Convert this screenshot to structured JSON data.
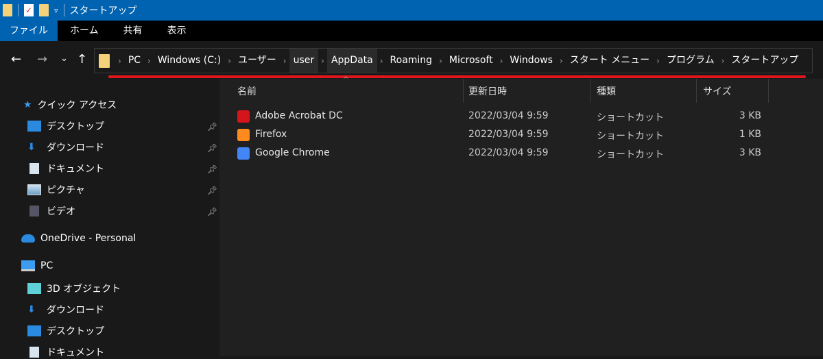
{
  "window": {
    "title": "スタートアップ"
  },
  "ribbon": {
    "tabs": [
      "ファイル",
      "ホーム",
      "共有",
      "表示"
    ]
  },
  "nav": {
    "back": "←",
    "forward": "→",
    "recent": "⌄",
    "up": "↑"
  },
  "breadcrumb": [
    "PC",
    "Windows (C:)",
    "ユーザー",
    "user",
    "AppData",
    "Roaming",
    "Microsoft",
    "Windows",
    "スタート メニュー",
    "プログラム",
    "スタートアップ"
  ],
  "sidebar": {
    "quick_access": "クイック アクセス",
    "quick_items": [
      "デスクトップ",
      "ダウンロード",
      "ドキュメント",
      "ピクチャ",
      "ビデオ"
    ],
    "onedrive": "OneDrive - Personal",
    "pc": "PC",
    "pc_items": [
      "3D オブジェクト",
      "ダウンロード",
      "デスクトップ",
      "ドキュメント"
    ]
  },
  "columns": {
    "name": "名前",
    "modified": "更新日時",
    "type": "種類",
    "size": "サイズ"
  },
  "files": [
    {
      "name": "Adobe Acrobat DC",
      "modified": "2022/03/04 9:59",
      "type": "ショートカット",
      "size": "3 KB",
      "icon": "acrobat-icon",
      "color": "#d4161c"
    },
    {
      "name": "Firefox",
      "modified": "2022/03/04 9:59",
      "type": "ショートカット",
      "size": "1 KB",
      "icon": "firefox-icon",
      "color": "#ff8a1e"
    },
    {
      "name": "Google Chrome",
      "modified": "2022/03/04 9:59",
      "type": "ショートカット",
      "size": "3 KB",
      "icon": "chrome-icon",
      "color": "#4285f4"
    }
  ],
  "colors": {
    "accent": "#0063b1",
    "highlight": "#e0161c"
  }
}
